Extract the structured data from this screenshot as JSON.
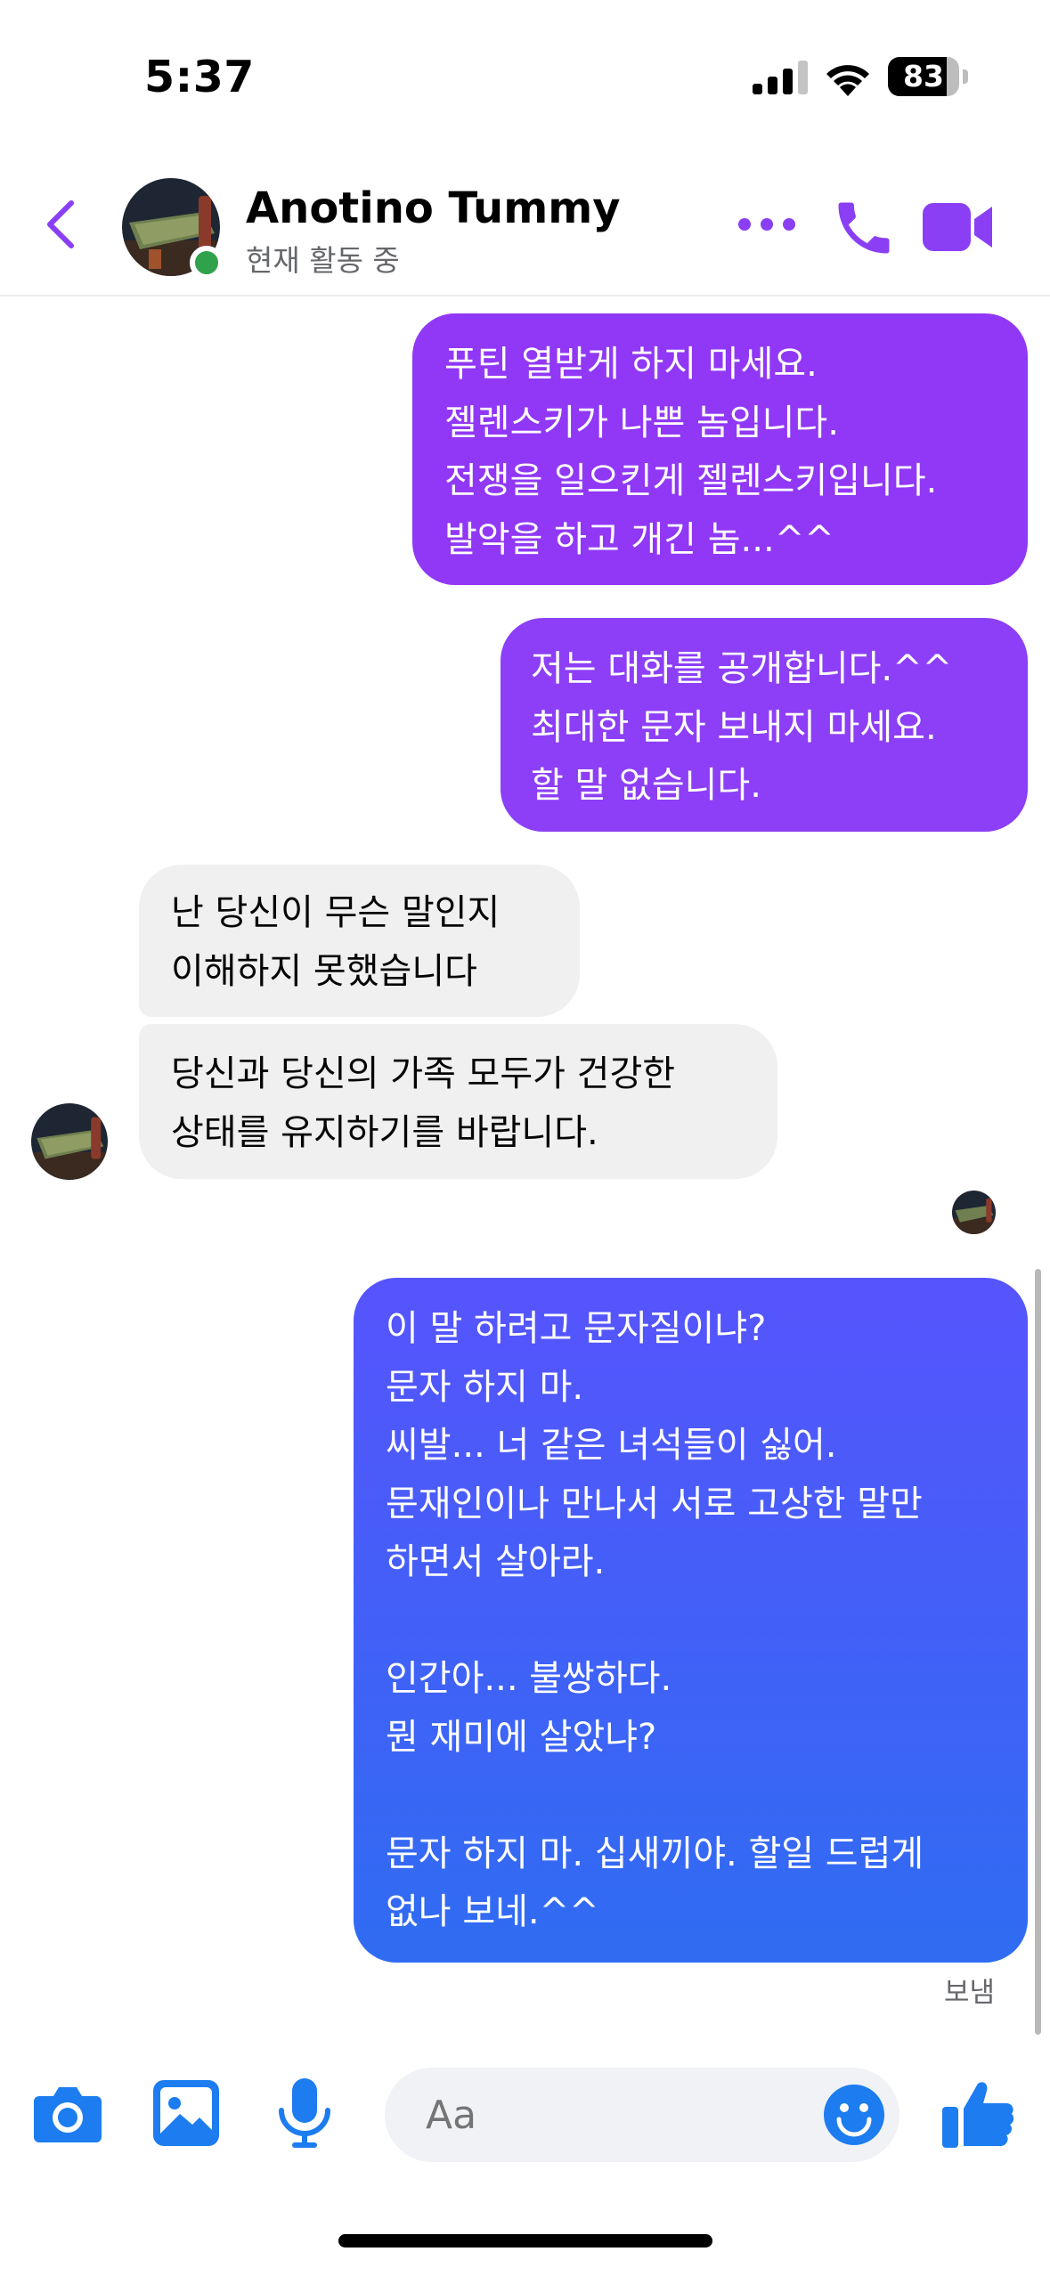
{
  "status_bar": {
    "time": "5:37",
    "battery": "83",
    "battery_fraction": 0.83
  },
  "header": {
    "contact_name": "Anotino Tummy",
    "contact_status": "현재 활동 중"
  },
  "messages": [
    {
      "direction": "outgoing",
      "text": "푸틴 열받게 하지 마세요.\n젤렌스키가 나쁜 놈입니다.\n전쟁을 일으킨게 젤렌스키입니다.\n발악을 하고 개긴 놈...^^"
    },
    {
      "direction": "outgoing",
      "text": "저는 대화를 공개합니다.^^\n최대한 문자 보내지 마세요.\n할 말 없습니다."
    },
    {
      "direction": "incoming",
      "text": "난 당신이 무슨 말인지\n이해하지 못했습니다"
    },
    {
      "direction": "incoming",
      "text": "당신과 당신의 가족 모두가 건강한\n상태를 유지하기를 바랍니다."
    },
    {
      "direction": "outgoing",
      "text": "이 말 하려고 문자질이냐?\n문자 하지 마.\n씨발... 너 같은 녀석들이 싫어.\n문재인이나 만나서 서로 고상한 말만\n하면서 살아라.\n\n인간아... 불쌍하다.\n뭔 재미에 살았냐?\n\n문자 하지 마. 십새끼야. 할일 드럽게\n없나 보네.^^"
    }
  ],
  "sent_label": "보냄",
  "composer": {
    "placeholder": "Aa"
  },
  "colors": {
    "accent": "#8a3ff5",
    "bubble_purple": "#9038f5",
    "bubble_blue_top": "#5654fd",
    "bubble_blue_bottom": "#2f6cf2",
    "icon_blue": "#1c7cf0",
    "incoming_bubble": "#f0f0f0",
    "online": "#31a24c"
  },
  "icons": [
    "back-chevron-icon",
    "more-icon",
    "phone-icon",
    "video-camera-icon",
    "camera-icon",
    "gallery-icon",
    "microphone-icon",
    "emoji-icon",
    "thumbs-up-icon"
  ]
}
